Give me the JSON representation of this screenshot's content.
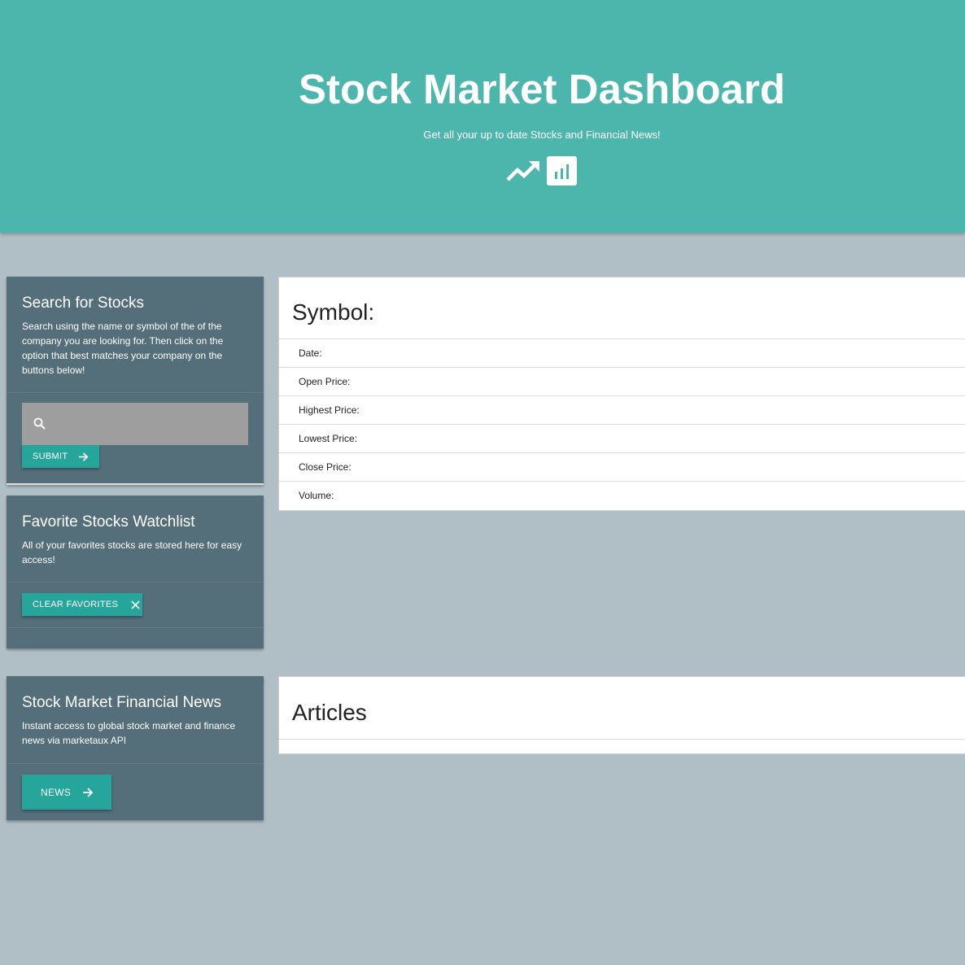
{
  "header": {
    "title": "Stock Market Dashboard",
    "subtitle": "Get all your up to date Stocks and Financial News!",
    "icons": [
      "trending-up-icon",
      "bar-chart-icon"
    ],
    "background_color": "#4db6ac"
  },
  "search_card": {
    "title": "Search for Stocks",
    "description": "Search using the name or symbol of the of the company you are looking for. Then click on the option that best matches your company on the buttons below!",
    "input": {
      "value": "",
      "placeholder": ""
    },
    "submit_label": "SUBMIT"
  },
  "favorites_card": {
    "title": "Favorite Stocks Watchlist",
    "description": "All of your favorites stocks are stored here for easy access!",
    "clear_label": "CLEAR FAVORITES"
  },
  "news_card": {
    "title": "Stock Market Financial News",
    "description": "Instant access to global stock market and finance news via marketaux API",
    "news_label": "NEWS"
  },
  "stock_panel": {
    "title": "Symbol:",
    "rows": [
      {
        "label": "Date:"
      },
      {
        "label": "Open Price:"
      },
      {
        "label": "Highest Price:"
      },
      {
        "label": "Lowest Price:"
      },
      {
        "label": "Close Price:"
      },
      {
        "label": "Volume:"
      }
    ]
  },
  "articles_panel": {
    "title": "Articles"
  },
  "colors": {
    "page_background": "#b0bec5",
    "card_background": "#546e7a",
    "button": "#26a69a",
    "input_background": "#9e9e9e"
  }
}
